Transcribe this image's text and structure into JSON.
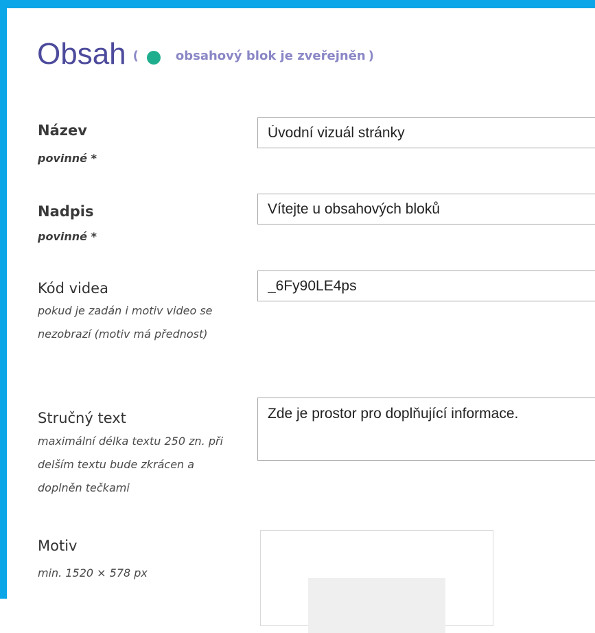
{
  "section": {
    "title": "Obsah",
    "status_open": "(",
    "status_text": "obsahový blok je zveřejněn",
    "status_close": ")",
    "status_color": "#1fae8d",
    "accent_color": "#0aa6e8"
  },
  "fields": {
    "nazev": {
      "label": "Název",
      "hint": "povinné *",
      "value": "Úvodní vizuál stránky"
    },
    "nadpis": {
      "label": "Nadpis",
      "hint": "povinné *",
      "value": "Vítejte u obsahových bloků"
    },
    "kod_videa": {
      "label": "Kód videa",
      "hint": "pokud je zadán i motiv video se nezobrazí (motiv má přednost)",
      "value": "_6Fy90LE4ps"
    },
    "strucny_text": {
      "label": "Stručný text",
      "hint": "maximální délka textu 250 zn. při delším textu bude zkrácen a doplněn tečkami",
      "value": "Zde je prostor pro doplňující informace."
    },
    "motiv": {
      "label": "Motiv",
      "hint": "min. 1520 × 578 px"
    }
  }
}
